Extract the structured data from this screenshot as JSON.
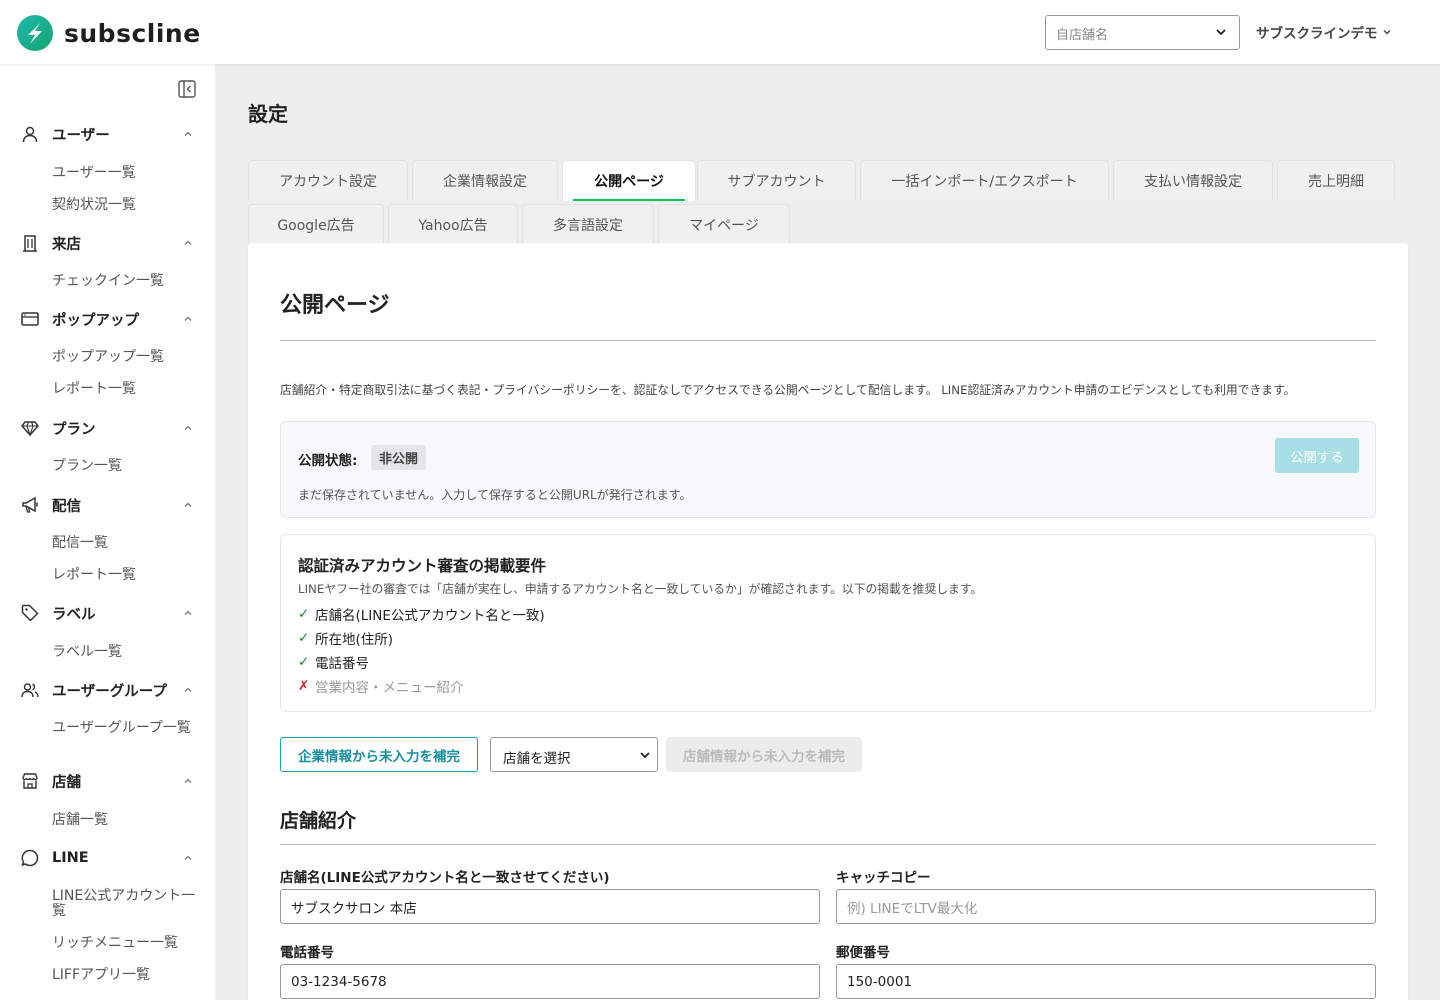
{
  "brand": {
    "name": "subscline",
    "accent": "#06c755",
    "teal": "#1aa0ae"
  },
  "header": {
    "store_select_placeholder": "自店舗名",
    "account_name": "サブスクラインデモ"
  },
  "sidebar": {
    "groups": [
      {
        "icon": "user-icon",
        "label": "ユーザー",
        "items": [
          "ユーザー一覧",
          "契約状況一覧"
        ]
      },
      {
        "icon": "building-icon",
        "label": "来店",
        "items": [
          "チェックイン一覧"
        ]
      },
      {
        "icon": "window-icon",
        "label": "ポップアップ",
        "items": [
          "ポップアップ一覧",
          "レポート一覧"
        ]
      },
      {
        "icon": "diamond-icon",
        "label": "プラン",
        "items": [
          "プラン一覧"
        ]
      },
      {
        "icon": "megaphone-icon",
        "label": "配信",
        "items": [
          "配信一覧",
          "レポート一覧"
        ]
      },
      {
        "icon": "tag-icon",
        "label": "ラベル",
        "items": [
          "ラベル一覧"
        ]
      },
      {
        "icon": "users-icon",
        "label": "ユーザーグループ",
        "items": [
          "ユーザーグループ一覧"
        ]
      },
      {
        "icon": "store-icon",
        "label": "店舗",
        "items": [
          "店舗一覧"
        ]
      },
      {
        "icon": "chat-icon",
        "label": "LINE",
        "items": [
          "LINE公式アカウント一覧",
          "リッチメニュー一覧",
          "LIFFアプリ一覧"
        ]
      }
    ]
  },
  "main": {
    "page_title": "設定",
    "tabs_row1": [
      "アカウント設定",
      "企業情報設定",
      "公開ページ",
      "サブアカウント",
      "一括インポート/エクスポート",
      "支払い情報設定",
      "売上明細"
    ],
    "tabs_row2": [
      "Google広告",
      "Yahoo広告",
      "多言語設定",
      "マイページ"
    ],
    "active_tab": "公開ページ"
  },
  "public_page": {
    "title": "公開ページ",
    "intro": "店舗紹介・特定商取引法に基づく表記・プライバシーポリシーを、認証なしでアクセスできる公開ページとして配信します。 LINE認証済みアカウント申請のエビデンスとしても利用できます。",
    "status_label": "公開状態:",
    "status_value": "非公開",
    "publish_button": "公開する",
    "status_note": "まだ保存されていません。入力して保存すると公開URLが発行されます。",
    "requirements": {
      "title": "認証済みアカウント審査の掲載要件",
      "description": "LINEヤフー社の審査では「店舗が実在し、申請するアカウント名と一致しているか」が確認されます。以下の掲載を推奨します。",
      "items": [
        {
          "mark": "✓",
          "text": "店舗名(LINE公式アカウント名と一致)",
          "ok": true
        },
        {
          "mark": "✓",
          "text": "所在地(住所)",
          "ok": true
        },
        {
          "mark": "✓",
          "text": "電話番号",
          "ok": true
        },
        {
          "mark": "✗",
          "text": "営業内容・メニュー紹介",
          "ok": false
        }
      ]
    },
    "fill_company_button": "企業情報から未入力を補完",
    "store_dropdown_value": "店舗を選択",
    "fill_store_button": "店舗情報から未入力を補完",
    "section_title": "店舗紹介",
    "fields": {
      "store_name_label": "店舗名(LINE公式アカウント名と一致させてください)",
      "store_name_value": "サブスクサロン 本店",
      "catchcopy_label": "キャッチコピー",
      "catchcopy_placeholder": "例) LINEでLTV最大化",
      "phone_label": "電話番号",
      "phone_value": "03-1234-5678",
      "postal_label": "郵便番号",
      "postal_value": "150-0001"
    }
  }
}
